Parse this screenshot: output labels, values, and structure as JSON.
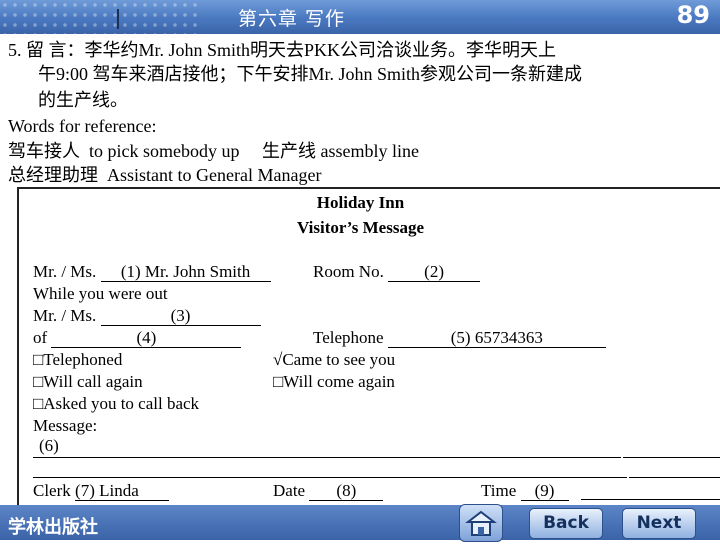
{
  "header": {
    "title": "第六章   写作",
    "page_number": "89"
  },
  "task": {
    "line1": "5. 留   言：李华约Mr. John Smith明天去PKK公司洽谈业务。李华明天上",
    "line2": "午9:00 驾车来酒店接他；下午安排Mr. John Smith参观公司一条新建成",
    "line3": "的生产线。",
    "ref_heading": "Words for reference:",
    "ref1": "驾车接人  to pick somebody up     生产线 assembly line",
    "ref2": "总经理助理  Assistant to General Manager"
  },
  "form": {
    "title1": "Holiday Inn",
    "title2": "Visitor’s Message",
    "mr_label": "Mr. / Ms.",
    "mr_value": "(1) Mr. John Smith",
    "room_label": "Room No.",
    "room_value": "(2)",
    "while_out": "While you were out",
    "mr2_label": "Mr. / Ms.",
    "mr2_value": "(3)",
    "of_label": "of",
    "of_value": "(4)",
    "tel_label": "Telephone",
    "tel_value": "(5) 65734363",
    "opt_telephoned": "□Telephoned",
    "opt_came": "√Came to see you",
    "opt_will_call": "□Will call again",
    "opt_will_come": "□Will come again",
    "opt_asked": "□Asked you to call back",
    "message_label": "Message:",
    "message_value": "(6)",
    "clerk_label": "Clerk",
    "clerk_value": "(7) Linda",
    "date_label": "Date",
    "date_value": "(8)",
    "time_label": "Time",
    "time_value": "(9)"
  },
  "footer": {
    "publisher": "学林出版社",
    "home_icon": "home-icon",
    "back_label": "Back",
    "next_label": "Next"
  },
  "colors": {
    "header_blue": "#4a78c0",
    "footer_blue": "#3a63a8",
    "button_text": "#14305f"
  }
}
